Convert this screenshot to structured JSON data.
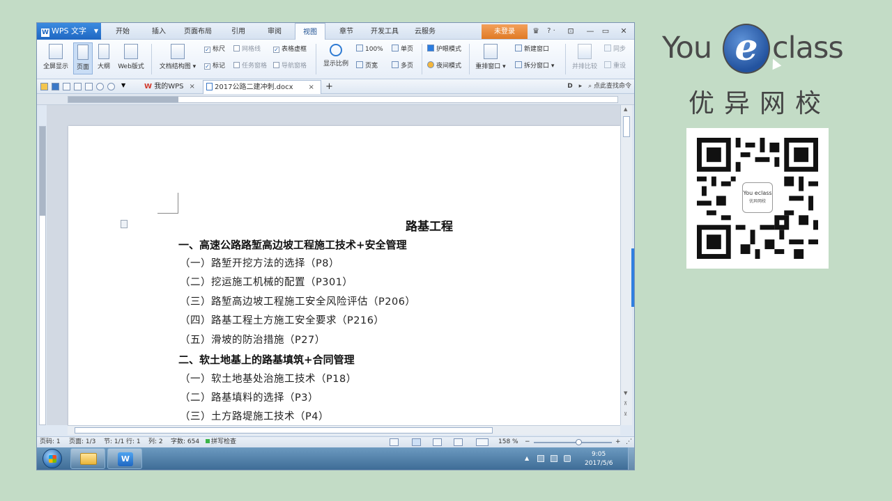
{
  "app": {
    "name": "WPS 文字",
    "logo_letter": "W",
    "login": "未登录",
    "help": "? ·"
  },
  "menu": {
    "tabs": [
      {
        "label": "开始"
      },
      {
        "label": "插入"
      },
      {
        "label": "页面布局"
      },
      {
        "label": "引用"
      },
      {
        "label": "审阅"
      },
      {
        "label": "视图"
      },
      {
        "label": "章节"
      },
      {
        "label": "开发工具"
      },
      {
        "label": "云服务"
      }
    ],
    "active_tab": "视图"
  },
  "ribbon": {
    "full_screen": "全屏显示",
    "page": "页面",
    "outline": "大纲",
    "web_layout": "Web版式",
    "doc_structure": "文档结构图",
    "ruler": "标尺",
    "gridlines": "网格线",
    "table_gridlines": "表格虚框",
    "marks": "标记",
    "task_pane": "任务窗格",
    "nav_pane": "导航窗格",
    "zoom": "显示比例",
    "zoom_100": "100%",
    "one_page": "单页",
    "page_width": "页宽",
    "multi_page": "多页",
    "eye_mode": "护眼模式",
    "night_mode": "夜间模式",
    "arrange_windows": "重排窗口",
    "new_window": "新建窗口",
    "split_window": "拆分窗口",
    "side_by_side": "并排比较",
    "sync_scroll": "同步",
    "reset": "重设"
  },
  "doc_tabs": {
    "my_wps": "我的WPS",
    "current_doc": "2017公路二建冲刺.docx",
    "close": "×",
    "add": "+",
    "find_command": "点此查找命令"
  },
  "document": {
    "title": "路基工程",
    "sections": [
      {
        "heading": "一、高速公路路堑高边坡工程施工技术+安全管理",
        "items": [
          "（一）路堑开挖方法的选择（P8）",
          "（二）挖运施工机械的配置（P301）",
          "（三）路堑高边坡工程施工安全风险评估（P206）",
          "（四）路基工程土方施工安全要求（P216）",
          "（五）滑坡的防治措施（P27）"
        ]
      },
      {
        "heading": "二、软土地基上的路基填筑+合同管理",
        "items": [
          "（一）软土地基处治施工技术（P18）",
          "（二）路基填料的选择（P3）",
          "（三）土方路堤施工技术（P4）"
        ]
      }
    ]
  },
  "status": {
    "page_no": "页码: 1",
    "pages": "页面: 1/3",
    "section": "节: 1/1",
    "row": "行: 1",
    "col": "列: 2",
    "words": "字数: 654",
    "spell_check": "拼写检查",
    "zoom": "158 %",
    "zoom_percent": 158,
    "zoom_minus": "−",
    "zoom_plus": "+"
  },
  "taskbar": {
    "time": "9:05",
    "date": "2017/5/6",
    "wps_letter": "W"
  },
  "brand": {
    "you": "You",
    "e": "e",
    "class": "class",
    "cn_name": "优异网校",
    "qr_badge_en": "You eclass",
    "qr_badge_cn": "优异网校"
  },
  "colors": {
    "accent_blue": "#1f67c2",
    "login_orange": "#e07a25",
    "background_green": "#c3dcc6"
  }
}
